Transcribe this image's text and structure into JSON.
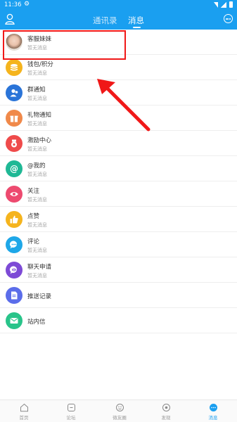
{
  "status_bar": {
    "time": "11:36"
  },
  "header": {
    "tabs": [
      {
        "label": "通讯录",
        "active": false
      },
      {
        "label": "消息",
        "active": true
      }
    ]
  },
  "messages": [
    {
      "title": "客服妹妹",
      "subtitle": "暂无消息",
      "icon": "avatar",
      "color": ""
    },
    {
      "title": "钱包/积分",
      "subtitle": "暂无消息",
      "icon": "coins-icon",
      "color": "#f5b41d"
    },
    {
      "title": "群通知",
      "subtitle": "暂无消息",
      "icon": "group-icon",
      "color": "#2a74d8"
    },
    {
      "title": "礼物通知",
      "subtitle": "暂无消息",
      "icon": "gift-icon",
      "color": "#f0894a"
    },
    {
      "title": "激励中心",
      "subtitle": "暂无消息",
      "icon": "medal-icon",
      "color": "#ef4b4b"
    },
    {
      "title": "@我的",
      "subtitle": "暂无消息",
      "icon": "at-icon",
      "color": "#1fb895"
    },
    {
      "title": "关注",
      "subtitle": "暂无消息",
      "icon": "eye-icon",
      "color": "#ed4a6f"
    },
    {
      "title": "点赞",
      "subtitle": "暂无消息",
      "icon": "thumbs-up-icon",
      "color": "#f5b41d"
    },
    {
      "title": "评论",
      "subtitle": "暂无消息",
      "icon": "comment-icon",
      "color": "#1ea7e8"
    },
    {
      "title": "聊天申请",
      "subtitle": "暂无消息",
      "icon": "chat-request-icon",
      "color": "#7d4ad6"
    },
    {
      "title": "推送记录",
      "subtitle": "",
      "icon": "document-icon",
      "color": "#5b6dea"
    },
    {
      "title": "站内信",
      "subtitle": "",
      "icon": "mail-icon",
      "color": "#29c48a"
    }
  ],
  "tab_bar": [
    {
      "label": "首页",
      "icon": "home-icon",
      "active": false
    },
    {
      "label": "论坛",
      "icon": "forum-icon",
      "active": false
    },
    {
      "label": "微友圈",
      "icon": "moments-icon",
      "active": false
    },
    {
      "label": "发现",
      "icon": "discover-icon",
      "active": false
    },
    {
      "label": "消息",
      "icon": "message-icon",
      "active": true
    }
  ],
  "colors": {
    "primary": "#1a9ff0",
    "highlight": "#f01818"
  }
}
